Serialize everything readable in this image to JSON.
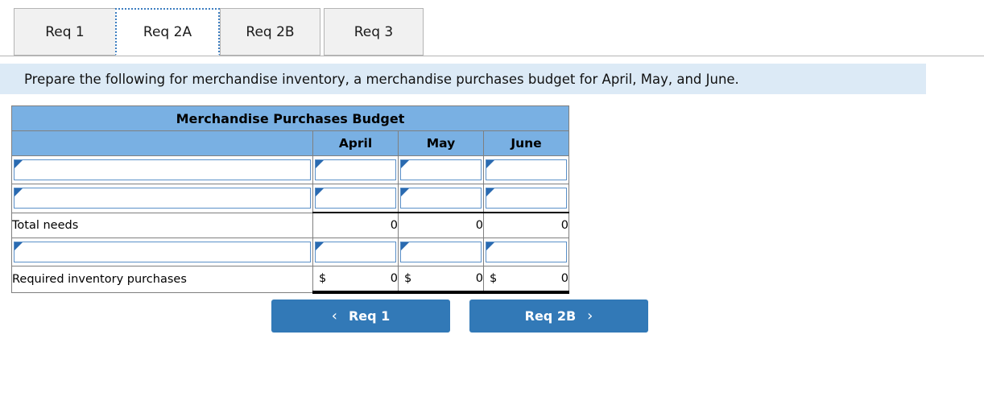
{
  "tabs": [
    {
      "label": "Req 1",
      "active": false
    },
    {
      "label": "Req 2A",
      "active": true
    },
    {
      "label": "Req 2B",
      "active": false
    },
    {
      "label": "Req 3",
      "active": false
    }
  ],
  "instruction": {
    "text": "Prepare the following for merchandise inventory, a merchandise purchases budget for April, May, and June."
  },
  "table": {
    "title": "Merchandise Purchases Budget",
    "columns": [
      "",
      "April",
      "May",
      "June"
    ],
    "rows": [
      {
        "type": "input",
        "label": "",
        "values": [
          "",
          "",
          ""
        ]
      },
      {
        "type": "input",
        "label": "",
        "values": [
          "",
          "",
          ""
        ]
      },
      {
        "type": "subtotal",
        "label": "Total needs",
        "values": [
          "0",
          "0",
          "0"
        ]
      },
      {
        "type": "input",
        "label": "",
        "values": [
          "",
          "",
          ""
        ]
      },
      {
        "type": "grandtotal",
        "label": "Required inventory purchases",
        "currency": "$",
        "values": [
          "0",
          "0",
          "0"
        ]
      }
    ]
  },
  "nav": {
    "prev_label": "Req 1",
    "next_label": "Req 2B",
    "prev_icon": "chevron-left-icon",
    "next_icon": "chevron-right-icon",
    "prev_glyph": "‹",
    "next_glyph": "›"
  },
  "colors": {
    "header_blue": "#79b0e3",
    "instruction_blue": "#dceaf6",
    "button_blue": "#3279b7",
    "input_border": "#5a90c8",
    "marker_blue": "#2a6ab0"
  }
}
